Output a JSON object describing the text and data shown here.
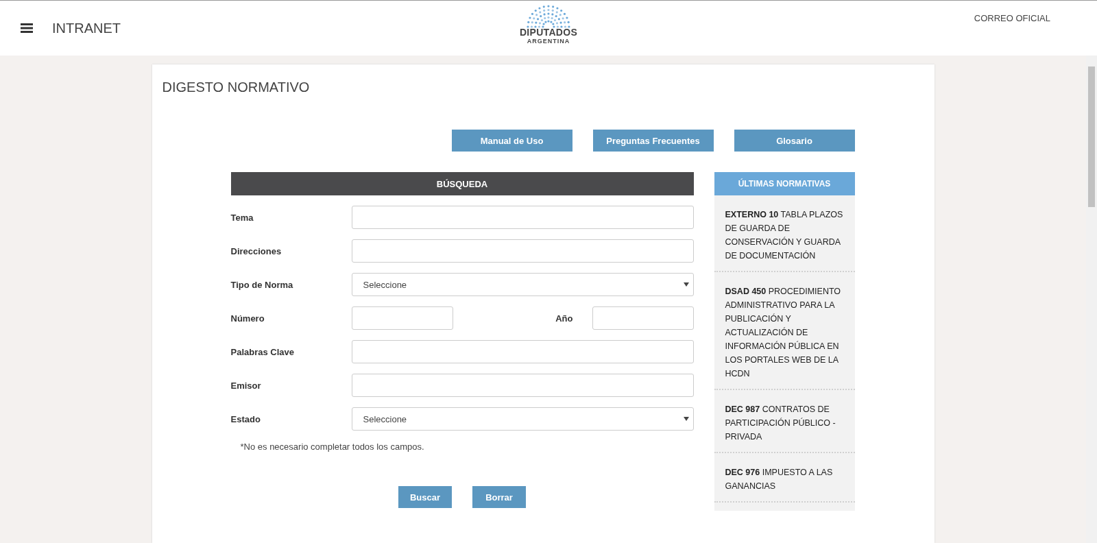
{
  "header": {
    "menu_label": "INTRANET",
    "logo_title": "DIPUTADOS",
    "logo_subtitle": "ARGENTINA",
    "link": "CORREO OFICIAL"
  },
  "page": {
    "title": "DIGESTO NORMATIVO"
  },
  "help_buttons": [
    "Manual de Uso",
    "Preguntas Frecuentes",
    "Glosario"
  ],
  "search": {
    "title": "BÚSQUEDA",
    "fields": [
      {
        "kind": "text",
        "label": "Tema"
      },
      {
        "kind": "text",
        "label": "Direcciones"
      },
      {
        "kind": "select",
        "label": "Tipo de Norma",
        "value": "Seleccione"
      },
      {
        "kind": "pair",
        "label": "Número",
        "label_2": "Año"
      },
      {
        "kind": "text",
        "label": "Palabras Clave"
      },
      {
        "kind": "text",
        "label": "Emisor"
      },
      {
        "kind": "select",
        "label": "Estado",
        "value": "Seleccione"
      }
    ],
    "note": "*No es necesario completar todos los campos.",
    "buttons": [
      "Buscar",
      "Borrar"
    ]
  },
  "latest": {
    "title": "ÚLTIMAS NORMATIVAS",
    "items": [
      "**EXTERNO 10** TABLA PLAZOS DE GUARDA DE CONSERVACIÓN Y GUARDA DE DOCUMENTACIÓN",
      "**DSAD 450** PROCEDIMIENTO ADMINISTRATIVO PARA LA PUBLICACIÓN Y ACTUALIZACIÓN DE INFORMACIÓN PÚBLICA EN LOS PORTALES WEB DE LA HCDN",
      "**DEC 987** CONTRATOS DE PARTICIPACIÓN PÚBLICO - PRIVADA",
      "**DEC 976** IMPUESTO A LAS GANANCIAS"
    ]
  }
}
